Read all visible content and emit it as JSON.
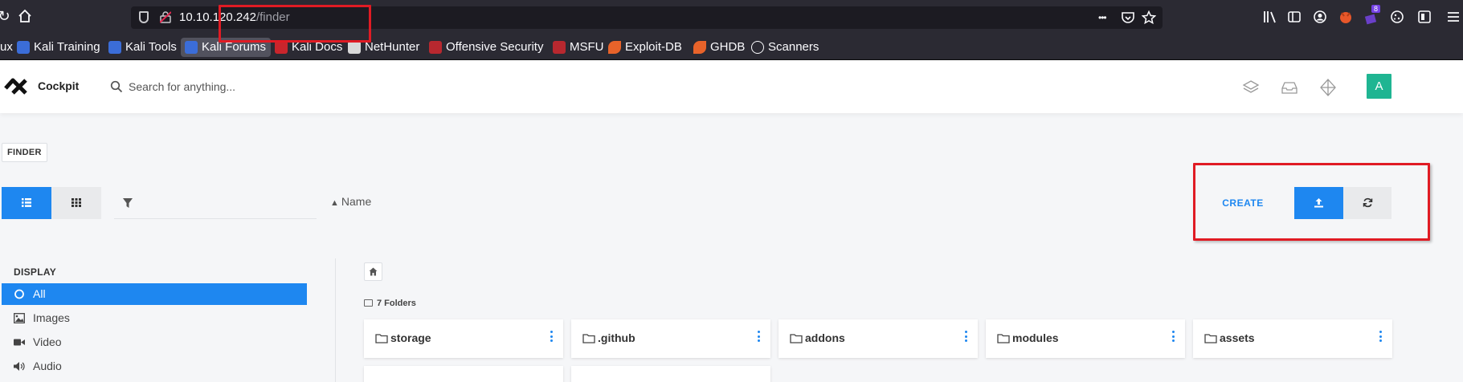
{
  "browser": {
    "url_host": "10.10.120.242",
    "url_path": "/finder",
    "more_label": "•••",
    "extension_badge": "8",
    "bookmarks": [
      {
        "label": "ux"
      },
      {
        "label": "Kali Training"
      },
      {
        "label": "Kali Tools"
      },
      {
        "label": "Kali Forums"
      },
      {
        "label": "Kali Docs"
      },
      {
        "label": "NetHunter"
      },
      {
        "label": "Offensive Security"
      },
      {
        "label": "MSFU"
      },
      {
        "label": "Exploit-DB"
      },
      {
        "label": "GHDB"
      },
      {
        "label": "Scanners"
      }
    ]
  },
  "app": {
    "name": "Cockpit",
    "search_placeholder": "Search for anything...",
    "avatar_letter": "A",
    "accent_color": "#1e87f0",
    "avatar_color": "#1fb592"
  },
  "page": {
    "label": "FINDER",
    "sort_label": "Name",
    "create_label": "CREATE",
    "filter_value": ""
  },
  "sidebar": {
    "heading": "DISPLAY",
    "items": [
      {
        "label": "All",
        "icon": "circle-icon",
        "active": true
      },
      {
        "label": "Images",
        "icon": "image-icon",
        "active": false
      },
      {
        "label": "Video",
        "icon": "video-icon",
        "active": false
      },
      {
        "label": "Audio",
        "icon": "audio-icon",
        "active": false
      }
    ]
  },
  "main": {
    "folders_count": "7 Folders",
    "folders": [
      {
        "name": "storage"
      },
      {
        "name": ".github"
      },
      {
        "name": "addons"
      },
      {
        "name": "modules"
      },
      {
        "name": "assets"
      }
    ]
  }
}
